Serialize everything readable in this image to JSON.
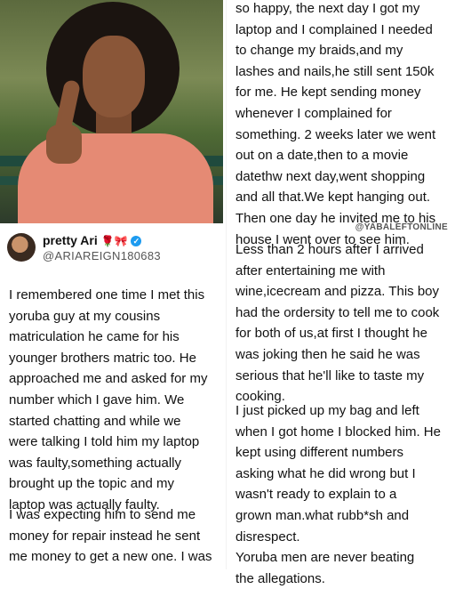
{
  "tweet": {
    "display_name": "pretty Ari",
    "badges": "🌹🎀",
    "verified_mark": "✓",
    "handle": "@ARIAREIGN180683"
  },
  "watermark": "@YABALEFTONLINE",
  "left_text": {
    "p1": "I remembered  one time I met this\nyoruba  guy  at my cousins\nmatriculation  he came for his\nyounger brothers matric  too. He\napproached me and asked  for my\nnumber which  I gave him. We\nstarted  chatting  and while we\nwere talking  I told him my laptop\nwas faulty,something  actually\nbrought  up the topic and my\nlaptop  was  actually faulty.",
    "p2": "I was expecting  him to send me\nmoney for repair instead  he sent\nme money to get a new one.  I was"
  },
  "right_text": {
    "p1": "so happy, the next day I got my\nlaptop and I complained I needed\nto change  my braids,and my\nlashes  and nails,he still sent 150k\nfor me. He kept  sending  money\nwhenever  I complained  for\nsomething.  2 weeks later we went\nout on a date,then to a movie\ndatethw next day,went shopping\nand all that.We kept hanging  out.\nThen one day he invited  me to his\nhouse I went over to see him.",
    "p2": "Less than 2 hours after I arrived\nafter entertaining  me with\nwine,icecream  and pizza. This boy\nhad the ordersity to tell me to cook\nfor both of us,at first I thought  he\nwas joking  then he said  he was\nserious  that he'll like to taste my\ncooking.",
    "p3": "I just picked  up my bag and left\nwhen I got home I blocked  him. He\nkept  using different numbers\nasking  what he did wrong  but I\nwasn't  ready to explain  to a\ngrown man.what rubb*sh  and\ndisrespect.\n Yoruba  men are never beating\nthe allegations."
  },
  "colors": {
    "text": "#111111",
    "verified": "#1d9bf0",
    "shirt": "#e58a74"
  }
}
